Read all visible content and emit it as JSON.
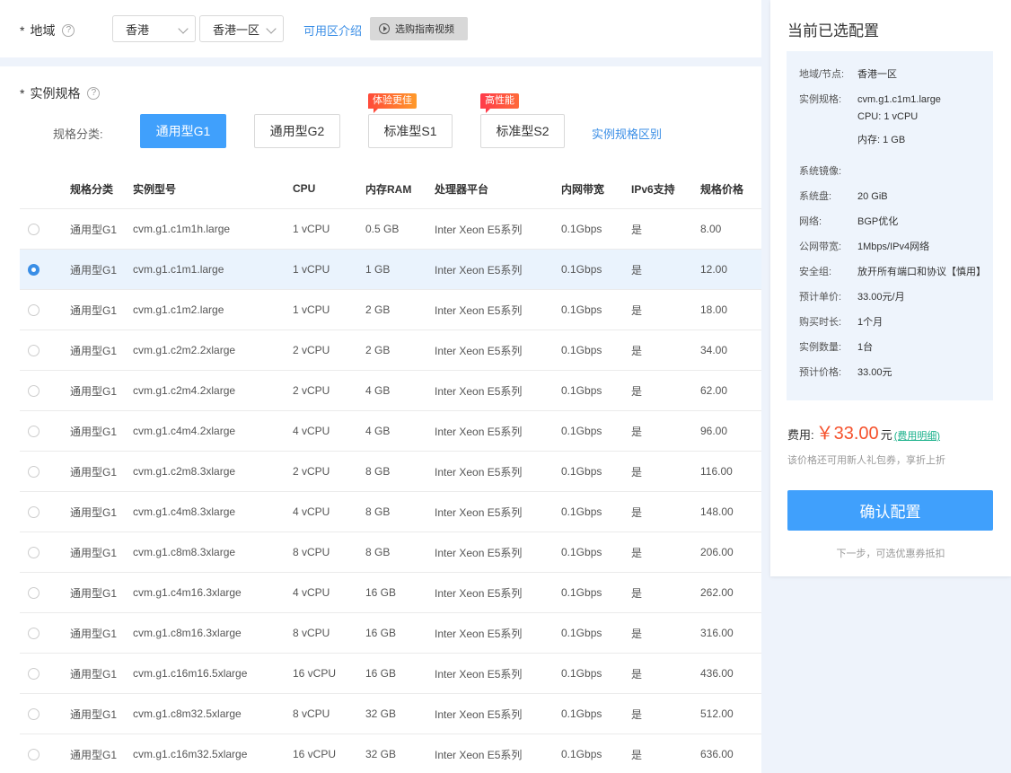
{
  "region": {
    "label": "地域",
    "required_mark": "*",
    "help": "?",
    "province": "香港",
    "zone": "香港一区",
    "zone_link": "可用区介绍",
    "video_button": "选购指南视频"
  },
  "spec": {
    "label": "实例规格",
    "required_mark": "*",
    "help": "?",
    "type_label": "规格分类:",
    "types": [
      {
        "label": "通用型G1",
        "badge": "",
        "active": true
      },
      {
        "label": "通用型G2",
        "badge": "",
        "active": false
      },
      {
        "label": "标准型S1",
        "badge": "体验更佳",
        "active": false
      },
      {
        "label": "标准型S2",
        "badge": "高性能",
        "active": false
      }
    ],
    "diff_link": "实例规格区别"
  },
  "table": {
    "headers": [
      "规格分类",
      "实例型号",
      "CPU",
      "内存RAM",
      "处理器平台",
      "内网带宽",
      "IPv6支持",
      "规格价格"
    ],
    "rows": [
      {
        "category": "通用型G1",
        "model": "cvm.g1.c1m1h.large",
        "cpu": "1 vCPU",
        "ram": "0.5 GB",
        "platform": "Inter Xeon E5系列",
        "bandwidth": "0.1Gbps",
        "ipv6": "是",
        "price": "8.00",
        "selected": false
      },
      {
        "category": "通用型G1",
        "model": "cvm.g1.c1m1.large",
        "cpu": "1 vCPU",
        "ram": "1 GB",
        "platform": "Inter Xeon E5系列",
        "bandwidth": "0.1Gbps",
        "ipv6": "是",
        "price": "12.00",
        "selected": true
      },
      {
        "category": "通用型G1",
        "model": "cvm.g1.c1m2.large",
        "cpu": "1 vCPU",
        "ram": "2 GB",
        "platform": "Inter Xeon E5系列",
        "bandwidth": "0.1Gbps",
        "ipv6": "是",
        "price": "18.00",
        "selected": false
      },
      {
        "category": "通用型G1",
        "model": "cvm.g1.c2m2.2xlarge",
        "cpu": "2 vCPU",
        "ram": "2 GB",
        "platform": "Inter Xeon E5系列",
        "bandwidth": "0.1Gbps",
        "ipv6": "是",
        "price": "34.00",
        "selected": false
      },
      {
        "category": "通用型G1",
        "model": "cvm.g1.c2m4.2xlarge",
        "cpu": "2 vCPU",
        "ram": "4 GB",
        "platform": "Inter Xeon E5系列",
        "bandwidth": "0.1Gbps",
        "ipv6": "是",
        "price": "62.00",
        "selected": false
      },
      {
        "category": "通用型G1",
        "model": "cvm.g1.c4m4.2xlarge",
        "cpu": "4 vCPU",
        "ram": "4 GB",
        "platform": "Inter Xeon E5系列",
        "bandwidth": "0.1Gbps",
        "ipv6": "是",
        "price": "96.00",
        "selected": false
      },
      {
        "category": "通用型G1",
        "model": "cvm.g1.c2m8.3xlarge",
        "cpu": "2 vCPU",
        "ram": "8 GB",
        "platform": "Inter Xeon E5系列",
        "bandwidth": "0.1Gbps",
        "ipv6": "是",
        "price": "116.00",
        "selected": false
      },
      {
        "category": "通用型G1",
        "model": "cvm.g1.c4m8.3xlarge",
        "cpu": "4 vCPU",
        "ram": "8 GB",
        "platform": "Inter Xeon E5系列",
        "bandwidth": "0.1Gbps",
        "ipv6": "是",
        "price": "148.00",
        "selected": false
      },
      {
        "category": "通用型G1",
        "model": "cvm.g1.c8m8.3xlarge",
        "cpu": "8 vCPU",
        "ram": "8 GB",
        "platform": "Inter Xeon E5系列",
        "bandwidth": "0.1Gbps",
        "ipv6": "是",
        "price": "206.00",
        "selected": false
      },
      {
        "category": "通用型G1",
        "model": "cvm.g1.c4m16.3xlarge",
        "cpu": "4 vCPU",
        "ram": "16 GB",
        "platform": "Inter Xeon E5系列",
        "bandwidth": "0.1Gbps",
        "ipv6": "是",
        "price": "262.00",
        "selected": false
      },
      {
        "category": "通用型G1",
        "model": "cvm.g1.c8m16.3xlarge",
        "cpu": "8 vCPU",
        "ram": "16 GB",
        "platform": "Inter Xeon E5系列",
        "bandwidth": "0.1Gbps",
        "ipv6": "是",
        "price": "316.00",
        "selected": false
      },
      {
        "category": "通用型G1",
        "model": "cvm.g1.c16m16.5xlarge",
        "cpu": "16 vCPU",
        "ram": "16 GB",
        "platform": "Inter Xeon E5系列",
        "bandwidth": "0.1Gbps",
        "ipv6": "是",
        "price": "436.00",
        "selected": false
      },
      {
        "category": "通用型G1",
        "model": "cvm.g1.c8m32.5xlarge",
        "cpu": "8 vCPU",
        "ram": "32 GB",
        "platform": "Inter Xeon E5系列",
        "bandwidth": "0.1Gbps",
        "ipv6": "是",
        "price": "512.00",
        "selected": false
      },
      {
        "category": "通用型G1",
        "model": "cvm.g1.c16m32.5xlarge",
        "cpu": "16 vCPU",
        "ram": "32 GB",
        "platform": "Inter Xeon E5系列",
        "bandwidth": "0.1Gbps",
        "ipv6": "是",
        "price": "636.00",
        "selected": false
      }
    ]
  },
  "summary": {
    "title": "当前已选配置",
    "items": [
      {
        "label": "地域/节点:",
        "value": "香港一区"
      },
      {
        "label": "实例规格:",
        "value": "cvm.g1.c1m1.large"
      },
      {
        "label": "",
        "value": "CPU: 1 vCPU"
      },
      {
        "label": "",
        "value": "内存: 1 GB"
      },
      {
        "label": "系统镜像:",
        "value": ""
      },
      {
        "label": "系统盘:",
        "value": "20 GiB"
      },
      {
        "label": "网络:",
        "value": "BGP优化"
      },
      {
        "label": "公网带宽:",
        "value": "1Mbps/IPv4网络"
      },
      {
        "label": "安全组:",
        "value": "放开所有端口和协议【慎用】"
      },
      {
        "label": "预计单价:",
        "value": "33.00元/月"
      },
      {
        "label": "购买时长:",
        "value": "1个月"
      },
      {
        "label": "实例数量:",
        "value": "1台"
      },
      {
        "label": "预计价格:",
        "value": "33.00元"
      }
    ],
    "fee_label": "费用:",
    "fee_price": "￥33.00",
    "fee_unit": "元",
    "fee_detail": "(费用明细)",
    "fee_note": "该价格还可用新人礼包券，享折上折",
    "confirm": "确认配置",
    "next_note": "下一步，可选优惠券抵扣"
  },
  "colors": {
    "accent": "#40a0fc",
    "price": "#f5522d",
    "link": "#3a8ee6"
  }
}
